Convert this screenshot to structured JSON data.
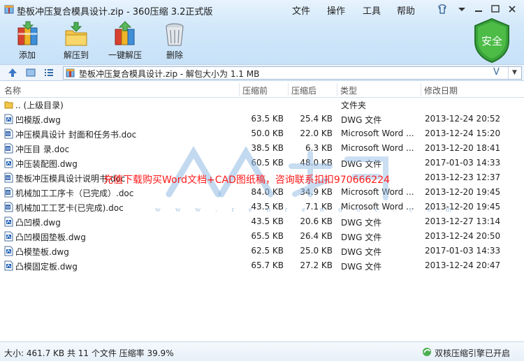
{
  "window": {
    "title": "垫板冲压复合模具设计.zip - 360压缩 3.2正式版",
    "menu": [
      "文件",
      "操作",
      "工具",
      "帮助"
    ]
  },
  "toolbar": {
    "add": "添加",
    "extract_to": "解压到",
    "one_click": "一键解压",
    "delete": "删除"
  },
  "shield": {
    "label": "安全",
    "color": "#3aa33a"
  },
  "address": {
    "path": "垫板冲压复合模具设计.zip - 解包大小为 1.1 MB",
    "v_glyph": "V"
  },
  "columns": {
    "name": "名称",
    "compressed": "压缩前",
    "after": "压缩后",
    "type": "类型",
    "modified": "修改日期"
  },
  "rows": [
    {
      "icon": "folder-icon",
      "name": ".. (上级目录)",
      "before": "",
      "after": "",
      "type": "文件夹",
      "date": ""
    },
    {
      "icon": "dwg-file-icon",
      "name": "凹模版.dwg",
      "before": "63.5 KB",
      "after": "25.4 KB",
      "type": "DWG 文件",
      "date": "2013-12-24 20:52"
    },
    {
      "icon": "doc-file-icon",
      "name": "冲压模具设计 封面和任务书.doc",
      "before": "50.0 KB",
      "after": "22.0 KB",
      "type": "Microsoft Word ...",
      "date": "2013-12-24 15:20"
    },
    {
      "icon": "doc-file-icon",
      "name": "冲压目    录.doc",
      "before": "38.5 KB",
      "after": "6.3 KB",
      "type": "Microsoft Word ...",
      "date": "2013-12-20 18:41"
    },
    {
      "icon": "dwg-file-icon",
      "name": "冲压装配图.dwg",
      "before": "60.5 KB",
      "after": "48.0 KB",
      "type": "DWG 文件",
      "date": "2017-01-03 14:33"
    },
    {
      "icon": "doc-file-icon",
      "name": "垫板冲压模具设计说明书.doc",
      "before": "",
      "after": "",
      "type": "",
      "date": "2013-12-23 12:37"
    },
    {
      "icon": "doc-file-icon",
      "name": "机械加工工序卡（已完成）.doc",
      "before": "84.0 KB",
      "after": "34.9 KB",
      "type": "Microsoft Word ...",
      "date": "2013-12-20 19:45"
    },
    {
      "icon": "doc-file-icon",
      "name": "机械加工工艺卡(已完成).doc",
      "before": "43.5 KB",
      "after": "7.1 KB",
      "type": "Microsoft Word ...",
      "date": "2013-12-20 19:45"
    },
    {
      "icon": "dwg-file-icon",
      "name": "凸凹模.dwg",
      "before": "43.5 KB",
      "after": "20.6 KB",
      "type": "DWG 文件",
      "date": "2013-12-27 13:14"
    },
    {
      "icon": "dwg-file-icon",
      "name": "凸凹模固垫板.dwg",
      "before": "65.5 KB",
      "after": "26.4 KB",
      "type": "DWG 文件",
      "date": "2013-12-24 20:50"
    },
    {
      "icon": "dwg-file-icon",
      "name": "凸模垫板.dwg",
      "before": "62.5 KB",
      "after": "25.0 KB",
      "type": "DWG 文件",
      "date": "2017-01-03 14:33"
    },
    {
      "icon": "dwg-file-icon",
      "name": "凸模固定板.dwg",
      "before": "65.7 KB",
      "after": "27.2 KB",
      "type": "DWG 文件",
      "date": "2013-12-24 20:47"
    }
  ],
  "watermark": {
    "text": "充值下载购买Word文档+CAD图纸稿，咨询联系扣扣970666224",
    "url": "w w w . r e n r e n d o c . c o m"
  },
  "status": {
    "summary": "大小: 461.7 KB 共 11 个文件 压缩率 39.9%",
    "engine": "双核压缩引擎已开启"
  }
}
